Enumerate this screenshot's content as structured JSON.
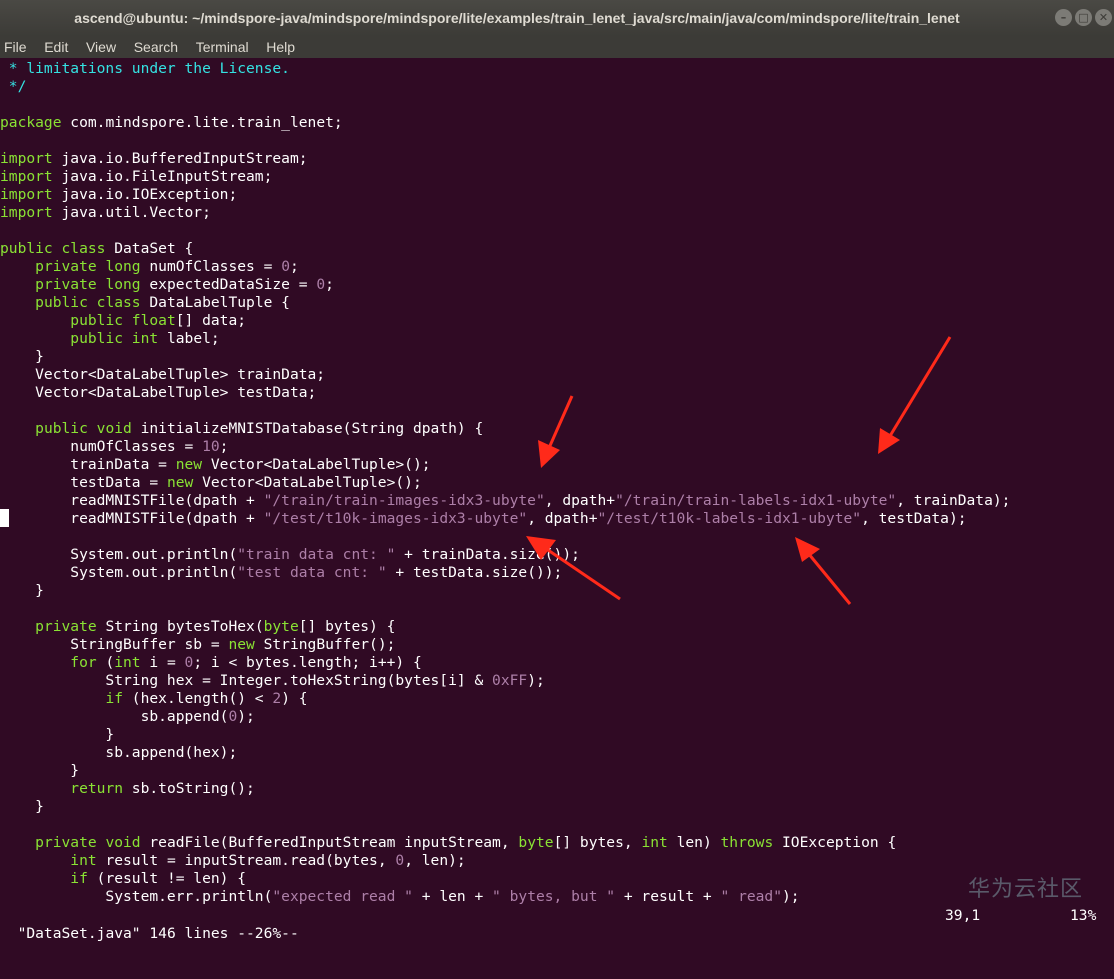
{
  "window": {
    "title": "ascend@ubuntu: ~/mindspore-java/mindspore/mindspore/lite/examples/train_lenet_java/src/main/java/com/mindspore/lite/train_lenet",
    "minimize_glyph": "–",
    "maximize_glyph": "□",
    "close_glyph": "✕"
  },
  "menu": {
    "file": "File",
    "edit": "Edit",
    "view": "View",
    "search": "Search",
    "terminal": "Terminal",
    "help": "Help"
  },
  "code_lines": [
    [
      {
        "t": " * limitations under the License.",
        "c": "cm"
      }
    ],
    [
      {
        "t": " */",
        "c": "cm"
      }
    ],
    [],
    [
      {
        "t": "package",
        "c": "kw"
      },
      {
        "t": " com.mindspore.lite.train_lenet;"
      }
    ],
    [],
    [
      {
        "t": "import",
        "c": "kw"
      },
      {
        "t": " java.io.BufferedInputStream;"
      }
    ],
    [
      {
        "t": "import",
        "c": "kw"
      },
      {
        "t": " java.io.FileInputStream;"
      }
    ],
    [
      {
        "t": "import",
        "c": "kw"
      },
      {
        "t": " java.io.IOException;"
      }
    ],
    [
      {
        "t": "import",
        "c": "kw"
      },
      {
        "t": " java.util.Vector;"
      }
    ],
    [],
    [
      {
        "t": "public class",
        "c": "kw"
      },
      {
        "t": " DataSet {"
      }
    ],
    [
      {
        "t": "    "
      },
      {
        "t": "private long",
        "c": "kw"
      },
      {
        "t": " numOfClasses = "
      },
      {
        "t": "0",
        "c": "num"
      },
      {
        "t": ";"
      }
    ],
    [
      {
        "t": "    "
      },
      {
        "t": "private long",
        "c": "kw"
      },
      {
        "t": " expectedDataSize = "
      },
      {
        "t": "0",
        "c": "num"
      },
      {
        "t": ";"
      }
    ],
    [
      {
        "t": "    "
      },
      {
        "t": "public class",
        "c": "kw"
      },
      {
        "t": " DataLabelTuple {"
      }
    ],
    [
      {
        "t": "        "
      },
      {
        "t": "public float",
        "c": "kw"
      },
      {
        "t": "[] data;"
      }
    ],
    [
      {
        "t": "        "
      },
      {
        "t": "public int",
        "c": "kw"
      },
      {
        "t": " label;"
      }
    ],
    [
      {
        "t": "    }"
      }
    ],
    [
      {
        "t": "    Vector<DataLabelTuple> trainData;"
      }
    ],
    [
      {
        "t": "    Vector<DataLabelTuple> testData;"
      }
    ],
    [],
    [
      {
        "t": "    "
      },
      {
        "t": "public void",
        "c": "kw"
      },
      {
        "t": " initializeMNISTDatabase(String dpath) {"
      }
    ],
    [
      {
        "t": "        numOfClasses = "
      },
      {
        "t": "10",
        "c": "num"
      },
      {
        "t": ";"
      }
    ],
    [
      {
        "t": "        trainData = "
      },
      {
        "t": "new",
        "c": "kw"
      },
      {
        "t": " Vector<DataLabelTuple>();"
      }
    ],
    [
      {
        "t": "        testData = "
      },
      {
        "t": "new",
        "c": "kw"
      },
      {
        "t": " Vector<DataLabelTuple>();"
      }
    ],
    [
      {
        "t": "        readMNISTFile(dpath + "
      },
      {
        "t": "\"/train/train-images-idx3-ubyte\"",
        "c": "str"
      },
      {
        "t": ", dpath+"
      },
      {
        "t": "\"/train/train-labels-idx1-ubyte\"",
        "c": "str"
      },
      {
        "t": ", trainData);"
      }
    ],
    [
      {
        "t": "        readMNISTFile(dpath + "
      },
      {
        "t": "\"/test/t10k-images-idx3-ubyte\"",
        "c": "str"
      },
      {
        "t": ", dpath+"
      },
      {
        "t": "\"/test/t10k-labels-idx1-ubyte\"",
        "c": "str"
      },
      {
        "t": ", testData);"
      }
    ],
    [],
    [
      {
        "t": "        System.out.println("
      },
      {
        "t": "\"train data cnt: \"",
        "c": "str"
      },
      {
        "t": " + trainData.size());"
      }
    ],
    [
      {
        "t": "        System.out.println("
      },
      {
        "t": "\"test data cnt: \"",
        "c": "str"
      },
      {
        "t": " + testData.size());"
      }
    ],
    [
      {
        "t": "    }"
      }
    ],
    [],
    [
      {
        "t": "    "
      },
      {
        "t": "private",
        "c": "kw"
      },
      {
        "t": " String bytesToHex("
      },
      {
        "t": "byte",
        "c": "kw"
      },
      {
        "t": "[] bytes) {"
      }
    ],
    [
      {
        "t": "        StringBuffer sb = "
      },
      {
        "t": "new",
        "c": "kw"
      },
      {
        "t": " StringBuffer();"
      }
    ],
    [
      {
        "t": "        "
      },
      {
        "t": "for",
        "c": "kw"
      },
      {
        "t": " ("
      },
      {
        "t": "int",
        "c": "kw"
      },
      {
        "t": " i = "
      },
      {
        "t": "0",
        "c": "num"
      },
      {
        "t": "; i < bytes.length; i++) {"
      }
    ],
    [
      {
        "t": "            String hex = Integer.toHexString(bytes[i] & "
      },
      {
        "t": "0xFF",
        "c": "num"
      },
      {
        "t": ");"
      }
    ],
    [
      {
        "t": "            "
      },
      {
        "t": "if",
        "c": "kw"
      },
      {
        "t": " (hex.length() < "
      },
      {
        "t": "2",
        "c": "num"
      },
      {
        "t": ") {"
      }
    ],
    [
      {
        "t": "                sb.append("
      },
      {
        "t": "0",
        "c": "num"
      },
      {
        "t": ");"
      }
    ],
    [
      {
        "t": "            }"
      }
    ],
    [
      {
        "t": "            sb.append(hex);"
      }
    ],
    [
      {
        "t": "        }"
      }
    ],
    [
      {
        "t": "        "
      },
      {
        "t": "return",
        "c": "kw"
      },
      {
        "t": " sb.toString();"
      }
    ],
    [
      {
        "t": "    }"
      }
    ],
    [],
    [
      {
        "t": "    "
      },
      {
        "t": "private void",
        "c": "kw"
      },
      {
        "t": " readFile(BufferedInputStream inputStream, "
      },
      {
        "t": "byte",
        "c": "kw"
      },
      {
        "t": "[] bytes, "
      },
      {
        "t": "int",
        "c": "kw"
      },
      {
        "t": " len) "
      },
      {
        "t": "throws",
        "c": "kw"
      },
      {
        "t": " IOException {"
      }
    ],
    [
      {
        "t": "        "
      },
      {
        "t": "int",
        "c": "kw"
      },
      {
        "t": " result = inputStream.read(bytes, "
      },
      {
        "t": "0",
        "c": "num"
      },
      {
        "t": ", len);"
      }
    ],
    [
      {
        "t": "        "
      },
      {
        "t": "if",
        "c": "kw"
      },
      {
        "t": " (result != len) {"
      }
    ],
    [
      {
        "t": "            System.err.println("
      },
      {
        "t": "\"expected read \"",
        "c": "str"
      },
      {
        "t": " + len + "
      },
      {
        "t": "\" bytes, but \"",
        "c": "str"
      },
      {
        "t": " + result + "
      },
      {
        "t": "\" read\"",
        "c": "str"
      },
      {
        "t": ");"
      }
    ]
  ],
  "status": {
    "file_info": "\"DataSet.java\" 146 lines --26%--",
    "cursor_pos": "39,1",
    "percent": "13%"
  },
  "watermark": "华为云社区",
  "colors": {
    "background": "#300a24",
    "keyword": "#8ae234",
    "string": "#ad7fa8",
    "comment": "#34e2e2",
    "text": "#ffffff",
    "annotation_arrow": "#ff2a1a"
  }
}
